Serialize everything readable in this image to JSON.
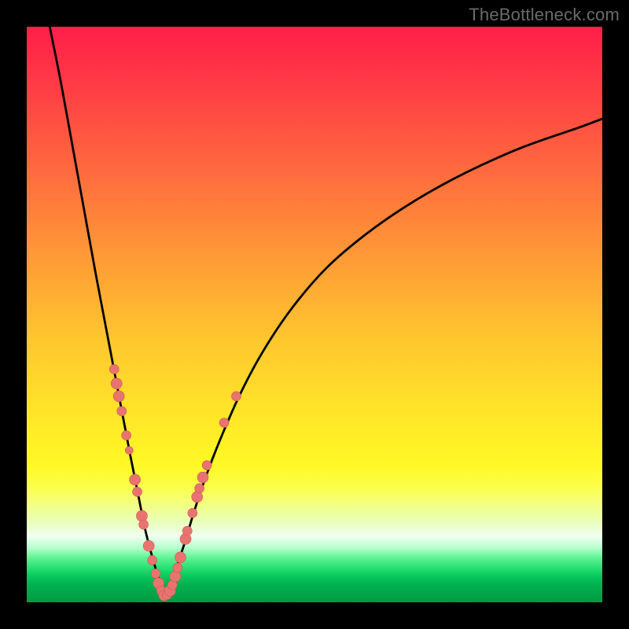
{
  "watermark": "TheBottleneck.com",
  "colors": {
    "frame": "#000000",
    "curve": "#000000",
    "dot_fill": "#e9746f",
    "dot_stroke": "#c85a55",
    "gradient_stops": [
      {
        "offset": 0.0,
        "color": "#ff1e49"
      },
      {
        "offset": 0.1,
        "color": "#ff3b45"
      },
      {
        "offset": 0.25,
        "color": "#ff6a3e"
      },
      {
        "offset": 0.4,
        "color": "#ff9a36"
      },
      {
        "offset": 0.55,
        "color": "#ffc82e"
      },
      {
        "offset": 0.68,
        "color": "#ffe728"
      },
      {
        "offset": 0.76,
        "color": "#fff825"
      },
      {
        "offset": 0.8,
        "color": "#fbff4a"
      },
      {
        "offset": 0.83,
        "color": "#f2ff82"
      },
      {
        "offset": 0.86,
        "color": "#e9ffba"
      },
      {
        "offset": 0.885,
        "color": "#f0fff0"
      },
      {
        "offset": 0.905,
        "color": "#b8ffcf"
      },
      {
        "offset": 0.92,
        "color": "#6bf59c"
      },
      {
        "offset": 0.94,
        "color": "#27e173"
      },
      {
        "offset": 0.955,
        "color": "#08c85d"
      },
      {
        "offset": 0.97,
        "color": "#02b14f"
      },
      {
        "offset": 1.0,
        "color": "#009a42"
      }
    ]
  },
  "chart_data": {
    "type": "line",
    "title": "",
    "xlabel": "",
    "ylabel": "",
    "xlim": [
      0,
      100
    ],
    "ylim": [
      0,
      100
    ],
    "notes": "V-shaped bottleneck curve. Minimum (best match) near x≈24. Background gradient encodes bottleneck severity: red=high, green=low. Pink dots mark sampled hardware data points along the curve.",
    "series": [
      {
        "name": "left-branch",
        "x": [
          4.0,
          6.0,
          8.0,
          10.0,
          12.0,
          14.0,
          16.0,
          18.0,
          19.5,
          20.5,
          21.5,
          22.5,
          23.5,
          24.0
        ],
        "y": [
          100,
          90.0,
          79.0,
          68.0,
          57.0,
          46.5,
          36.0,
          25.5,
          18.0,
          13.0,
          9.0,
          5.5,
          2.5,
          1.0
        ]
      },
      {
        "name": "right-branch",
        "x": [
          24.0,
          25.0,
          26.0,
          27.5,
          29.0,
          31.0,
          33.5,
          37.0,
          41.0,
          46.0,
          52.0,
          59.0,
          67.0,
          76.0,
          86.0,
          96.0,
          100.0
        ],
        "y": [
          1.0,
          3.0,
          6.0,
          10.5,
          15.5,
          21.5,
          28.0,
          36.0,
          43.5,
          51.0,
          58.0,
          64.0,
          69.5,
          74.5,
          79.0,
          82.5,
          84.0
        ]
      }
    ],
    "scatter": {
      "name": "sample-points",
      "points": [
        {
          "x": 15.2,
          "y": 40.5,
          "r": 6
        },
        {
          "x": 15.6,
          "y": 38.0,
          "r": 7
        },
        {
          "x": 16.0,
          "y": 35.8,
          "r": 7
        },
        {
          "x": 16.5,
          "y": 33.2,
          "r": 6
        },
        {
          "x": 17.3,
          "y": 29.0,
          "r": 6
        },
        {
          "x": 17.8,
          "y": 26.4,
          "r": 5
        },
        {
          "x": 18.8,
          "y": 21.3,
          "r": 7
        },
        {
          "x": 19.2,
          "y": 19.2,
          "r": 6
        },
        {
          "x": 20.0,
          "y": 15.0,
          "r": 7
        },
        {
          "x": 20.3,
          "y": 13.5,
          "r": 6
        },
        {
          "x": 21.2,
          "y": 9.8,
          "r": 7
        },
        {
          "x": 21.8,
          "y": 7.3,
          "r": 6
        },
        {
          "x": 22.4,
          "y": 5.0,
          "r": 6
        },
        {
          "x": 22.9,
          "y": 3.3,
          "r": 7
        },
        {
          "x": 23.4,
          "y": 2.0,
          "r": 6
        },
        {
          "x": 23.9,
          "y": 1.2,
          "r": 7
        },
        {
          "x": 24.4,
          "y": 1.3,
          "r": 6
        },
        {
          "x": 24.9,
          "y": 2.0,
          "r": 7
        },
        {
          "x": 25.3,
          "y": 3.0,
          "r": 6
        },
        {
          "x": 25.8,
          "y": 4.5,
          "r": 7
        },
        {
          "x": 26.2,
          "y": 6.0,
          "r": 6
        },
        {
          "x": 26.7,
          "y": 7.8,
          "r": 7
        },
        {
          "x": 27.6,
          "y": 11.0,
          "r": 7
        },
        {
          "x": 27.9,
          "y": 12.4,
          "r": 6
        },
        {
          "x": 28.8,
          "y": 15.5,
          "r": 6
        },
        {
          "x": 29.6,
          "y": 18.3,
          "r": 7
        },
        {
          "x": 30.0,
          "y": 19.8,
          "r": 6
        },
        {
          "x": 30.6,
          "y": 21.7,
          "r": 7
        },
        {
          "x": 31.3,
          "y": 23.8,
          "r": 6
        },
        {
          "x": 34.3,
          "y": 31.2,
          "r": 6
        },
        {
          "x": 36.4,
          "y": 35.8,
          "r": 6
        }
      ]
    }
  }
}
